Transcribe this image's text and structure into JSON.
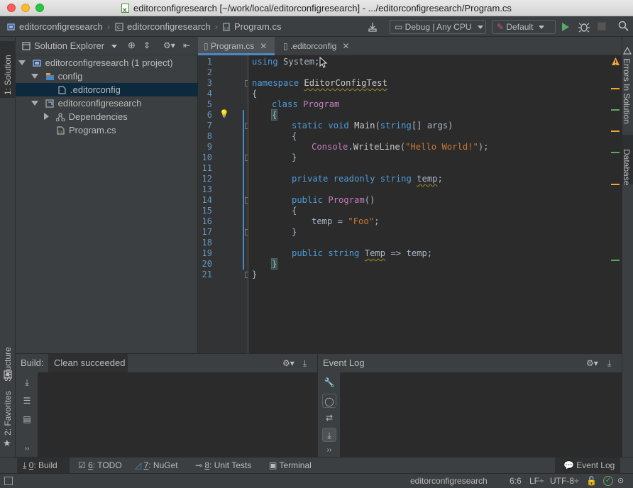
{
  "window": {
    "title": "editorconfigresearch [~/work/local/editorconfigresearch] - .../editorconfigresearch/Program.cs"
  },
  "breadcrumbs": [
    "editorconfigresearch",
    "editorconfigresearch",
    "Program.cs"
  ],
  "toolbar": {
    "config": "Debug | Any CPU",
    "profile": "Default"
  },
  "left_strip": {
    "solution_tab": "1: Solution",
    "structure_tab": "Structure",
    "favorites_tab": "2: Favorites"
  },
  "right_strip": {
    "errors_tab": "Errors In Solution",
    "database_tab": "Database"
  },
  "solution_explorer": {
    "title": "Solution Explorer",
    "items": [
      {
        "label": "editorconfigresearch (1 project)",
        "level": 0
      },
      {
        "label": "config",
        "level": 1
      },
      {
        "label": ".editorconfig",
        "level": 2
      },
      {
        "label": "editorconfigresearch",
        "level": 1
      },
      {
        "label": "Dependencies",
        "level": 2
      },
      {
        "label": "Program.cs",
        "level": 2
      }
    ]
  },
  "editor_tabs": [
    {
      "label": "Program.cs",
      "active": true
    },
    {
      "label": ".editorconfig",
      "active": false
    }
  ],
  "code": {
    "line_numbers": [
      "1",
      "2",
      "3",
      "4",
      "5",
      "6",
      "7",
      "8",
      "9",
      "10",
      "11",
      "12",
      "13",
      "14",
      "15",
      "16",
      "17",
      "18",
      "19",
      "20",
      "21"
    ],
    "l1_kw": "using",
    "l1_rest": " System;",
    "l3_kw": "namespace",
    "l3_name": "EditorConfigTest",
    "l4": "{",
    "l5_kw": "class",
    "l5_name": "Program",
    "l6": "{",
    "l7_kw1": "static",
    "l7_kw2": "void",
    "l7_name": "Main",
    "l7_p1": "(",
    "l7_type": "string",
    "l7_rest": "[] args)",
    "l8": "{",
    "l9_cls": "Console",
    "l9_dot": ".",
    "l9_m": "WriteLine",
    "l9_p": "(",
    "l9_str": "\"Hello World!\"",
    "l9_end": ");",
    "l10": "}",
    "l12_kw1": "private",
    "l12_kw2": "readonly",
    "l12_kw3": "string",
    "l12_name": "temp",
    "l12_end": ";",
    "l14_kw": "public",
    "l14_name": "Program",
    "l14_end": "()",
    "l15": "{",
    "l16_a": "temp = ",
    "l16_str": "\"Foo\"",
    "l16_end": ";",
    "l17": "}",
    "l19_kw1": "public",
    "l19_kw2": "string",
    "l19_name": "Temp",
    "l19_rest": " => temp;",
    "l20": "}",
    "l21": "}"
  },
  "build_panel": {
    "label": "Build:",
    "tab": "Clean succeeded"
  },
  "event_panel": {
    "label": "Event Log"
  },
  "bottom_tabs": [
    {
      "key": "0",
      "label": ": Build"
    },
    {
      "key": "6",
      "label": ": TODO"
    },
    {
      "key": "7",
      "label": ": NuGet"
    },
    {
      "key": "8",
      "label": ": Unit Tests"
    },
    {
      "key": "",
      "label": "Terminal"
    }
  ],
  "event_log_tab": "Event Log",
  "status": {
    "project": "editorconfigresearch",
    "position": "6:6",
    "line_sep": "LF÷",
    "encoding": "UTF-8÷"
  },
  "colors": {
    "accent": "#4a88c7",
    "selection": "#0d293e",
    "warning": "#f0a732",
    "ok": "#59a869"
  }
}
